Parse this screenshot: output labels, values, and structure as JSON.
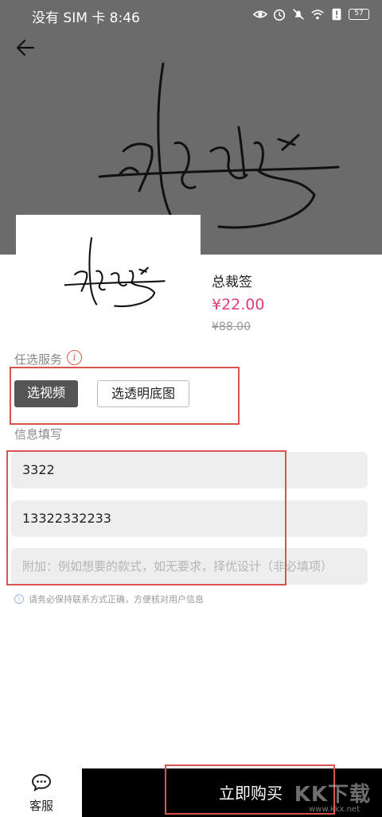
{
  "status": {
    "carrier_time": "没有 SIM 卡 8:46",
    "battery": "57"
  },
  "product": {
    "name": "总裁签",
    "price": "¥22.00",
    "original_price": "¥88.00"
  },
  "services": {
    "label": "任选服务",
    "info_glyph": "i",
    "option_video": "选视频",
    "option_transparent": "选透明底图",
    "selected": "选视频"
  },
  "info": {
    "label": "信息填写",
    "name_value": "3322",
    "phone_value": "13322332233",
    "extra_placeholder": "附加：例如想要的款式，如无要求，择优设计（非必填项）",
    "note_glyph": "i",
    "note": "请务必保持联系方式正确，方便核对用户信息"
  },
  "bottom": {
    "service_label": "客服",
    "buy_label": "立即购买"
  },
  "watermark": {
    "main": "KK下载",
    "sub": "www.kkx.net"
  },
  "colors": {
    "price": "#e23c74",
    "hero_bg": "#6b6b6b",
    "highlight_box": "#d9534f",
    "buy_bg": "#000000"
  },
  "icons": {
    "back": "arrow-left-icon",
    "service": "chat-bubble-icon",
    "info": "info-circle-icon"
  }
}
